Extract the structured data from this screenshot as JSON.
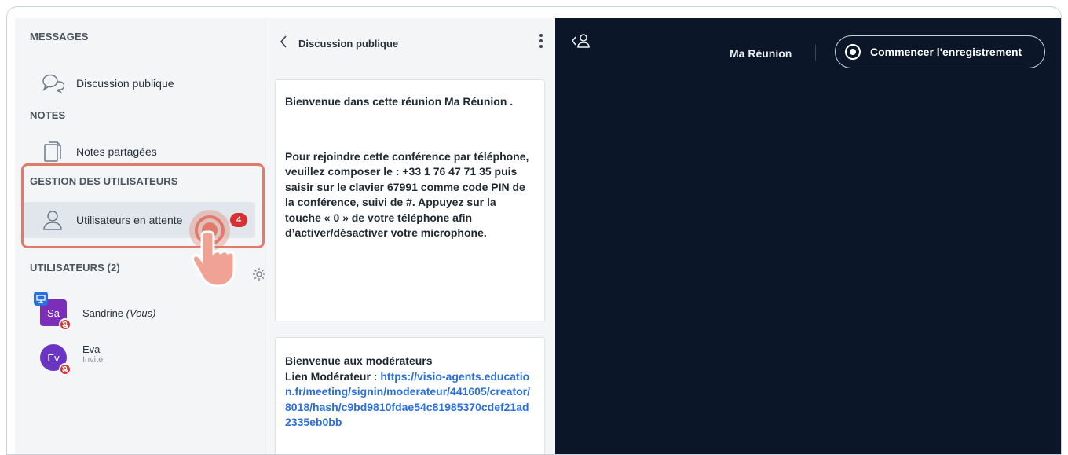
{
  "sidebar": {
    "messages_title": "MESSAGES",
    "public_chat_label": "Discussion publique",
    "notes_title": "NOTES",
    "shared_notes_label": "Notes partagées",
    "user_management_title": "GESTION DES UTILISATEURS",
    "waiting_users_label": "Utilisateurs en attente",
    "waiting_users_count": "4",
    "users_title": "UTILISATEURS (2)",
    "users": [
      {
        "initials": "Sa",
        "name": "Sandrine",
        "suffix": "(Vous)",
        "role": ""
      },
      {
        "initials": "Ev",
        "name": "Eva",
        "suffix": "",
        "role": "Invité"
      }
    ]
  },
  "chat": {
    "title": "Discussion publique",
    "messages": [
      {
        "line1": "Bienvenue dans cette réunion Ma Réunion .",
        "line2": "Pour rejoindre cette conférence par téléphone, veuillez composer le : +33 1 76 47 71 35 puis saisir sur le clavier 67991 comme code PIN de la conférence, suivi de #. Appuyez sur la touche « 0 » de votre téléphone afin d’activer/désactiver votre microphone."
      },
      {
        "line1": "Bienvenue aux modérateurs",
        "link_prefix": "Lien Modérateur : ",
        "link": "https://visio-agents.education.fr/meeting/signin/moderateur/441605/creator/8018/hash/c9bd9810fdae54c81985370cdef21ad2335eb0bb"
      }
    ]
  },
  "header": {
    "meeting_name": "Ma Réunion",
    "record_label": "Commencer l'enregistrement"
  },
  "colors": {
    "accent_red": "#d63031",
    "highlight": "#e07a6a",
    "link_blue": "#2b6fdc",
    "main_bg": "#0b1728"
  }
}
